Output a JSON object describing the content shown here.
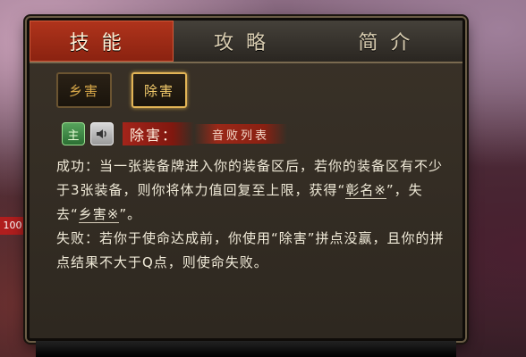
{
  "side_tag": "100",
  "tabs": [
    {
      "label": "技能",
      "active": true
    },
    {
      "label": "攻略",
      "active": false
    },
    {
      "label": "简介",
      "active": false
    }
  ],
  "skill_buttons": [
    {
      "label": "乡害",
      "selected": false
    },
    {
      "label": "除害",
      "selected": true
    }
  ],
  "skill": {
    "lord_icon_text": "主",
    "name": "除害：",
    "voice": "音败列表"
  },
  "description": {
    "success_text_1": "成功：当一张装备牌进入你的装备区后，若你的装备区有不少于3张装备，则你将体力值回复至上限，获得“",
    "term_1": "彰名※",
    "success_text_2": "”，失去“",
    "term_2": "乡害※",
    "success_text_3": "”。",
    "failure_text": "失败：若你于使命达成前，你使用“除害”拼点没赢，且你的拼点结果不大于Q点，则使命失败。"
  },
  "colors": {
    "active_tab": "#b0341c",
    "selected_button_border": "#e2b456",
    "text": "#f0ead8"
  }
}
